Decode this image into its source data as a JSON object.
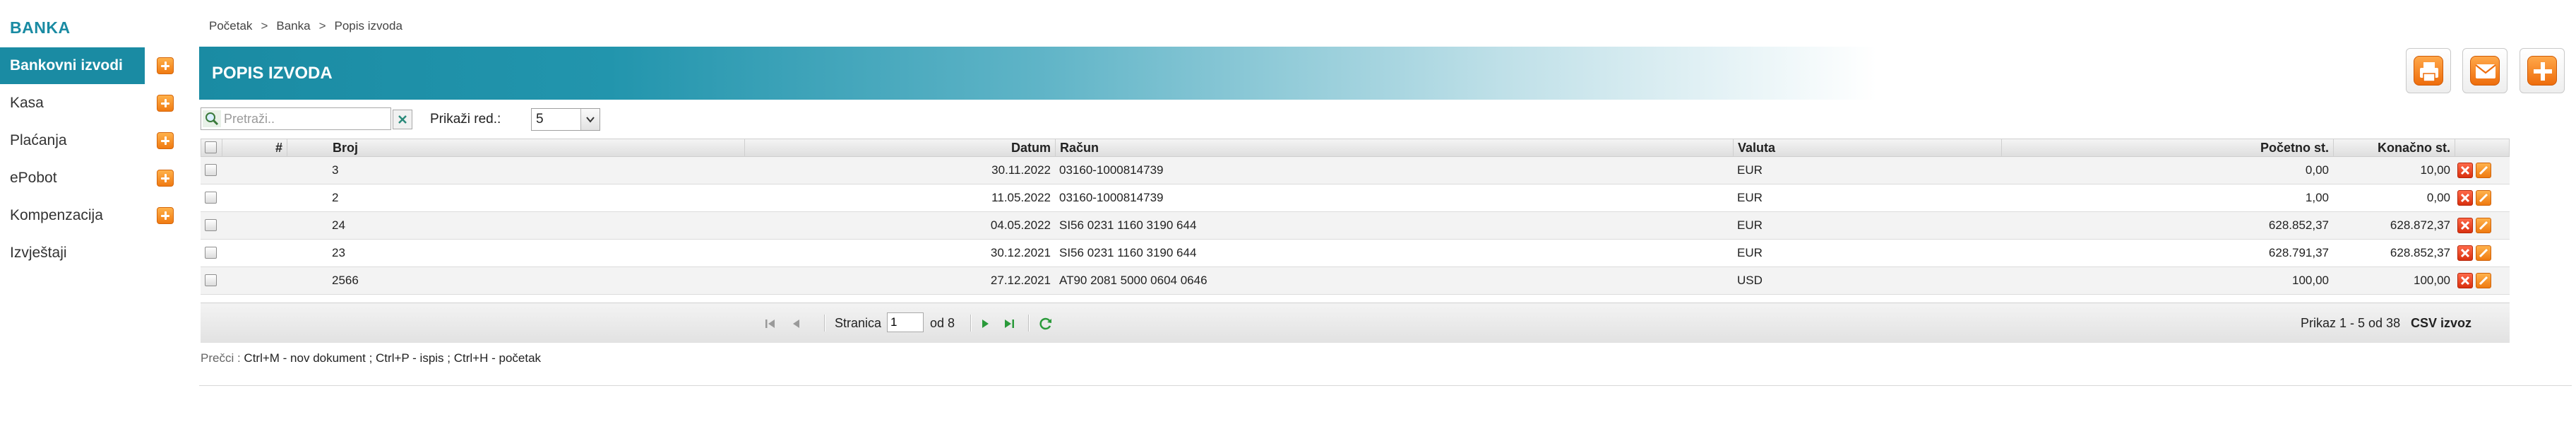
{
  "sidebar": {
    "brand": "BANKA",
    "items": [
      {
        "label": "Bankovni izvodi",
        "active": true,
        "has_add": true
      },
      {
        "label": "Kasa",
        "active": false,
        "has_add": true
      },
      {
        "label": "Plaćanja",
        "active": false,
        "has_add": true
      },
      {
        "label": "ePobot",
        "active": false,
        "has_add": true
      },
      {
        "label": "Kompenzacija",
        "active": false,
        "has_add": true
      },
      {
        "label": "Izvještaji",
        "active": false,
        "has_add": false
      }
    ]
  },
  "breadcrumb": {
    "items": [
      "Početak",
      "Banka",
      "Popis izvoda"
    ],
    "separator": ">"
  },
  "header": {
    "title": "POPIS IZVODA"
  },
  "actions": {
    "print_icon": "printer-icon",
    "email_icon": "envelope-icon",
    "add_icon": "plus-icon"
  },
  "toolbar": {
    "search_placeholder": "Pretraži..",
    "search_value": "",
    "rows_label": "Prikaži red.:",
    "rows_value": "5"
  },
  "table": {
    "columns": [
      "#",
      "Broj",
      "Datum",
      "Račun",
      "Valuta",
      "Početno st.",
      "Konačno st."
    ],
    "rows": [
      {
        "num": "",
        "broj": "3",
        "datum": "30.11.2022",
        "racun": "03160-1000814739",
        "valuta": "EUR",
        "pocetno": "0,00",
        "konacno": "10,00"
      },
      {
        "num": "",
        "broj": "2",
        "datum": "11.05.2022",
        "racun": "03160-1000814739",
        "valuta": "EUR",
        "pocetno": "1,00",
        "konacno": "0,00"
      },
      {
        "num": "",
        "broj": "24",
        "datum": "04.05.2022",
        "racun": "SI56 0231 1160 3190 644",
        "valuta": "EUR",
        "pocetno": "628.852,37",
        "konacno": "628.872,37"
      },
      {
        "num": "",
        "broj": "23",
        "datum": "30.12.2021",
        "racun": "SI56 0231 1160 3190 644",
        "valuta": "EUR",
        "pocetno": "628.791,37",
        "konacno": "628.852,37"
      },
      {
        "num": "",
        "broj": "2566",
        "datum": "27.12.2021",
        "racun": "AT90 2081 5000 0604 0646",
        "valuta": "USD",
        "pocetno": "100,00",
        "konacno": "100,00"
      }
    ]
  },
  "pager": {
    "page_label": "Stranica",
    "page_value": "1",
    "of_label": "od 8",
    "summary": "Prikaz 1 - 5 od 38",
    "csv_label": "CSV izvoz"
  },
  "shortcuts": {
    "label": "Prečci :",
    "items": [
      "Ctrl+M - nov dokument ;",
      "Ctrl+P - ispis ;",
      "Ctrl+H - početak"
    ]
  },
  "colors": {
    "accent": "#1a8ba3",
    "action_orange": "#f07a12",
    "delete_red": "#d9300f"
  }
}
